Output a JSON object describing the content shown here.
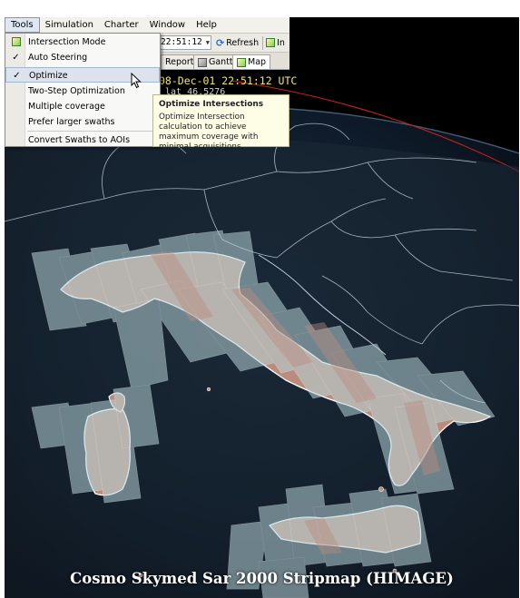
{
  "menubar": {
    "items": [
      {
        "label": "Tools",
        "active": true
      },
      {
        "label": "Simulation",
        "active": false
      },
      {
        "label": "Charter",
        "active": false
      },
      {
        "label": "Window",
        "active": false
      },
      {
        "label": "Help",
        "active": false
      }
    ]
  },
  "toolbar": {
    "time_value": "22:51:12",
    "refresh_label": "Refresh",
    "in_label": "In"
  },
  "tabs": [
    {
      "label": "Report",
      "icon": "report-icon"
    },
    {
      "label": "Gantt",
      "icon": "gantt-icon"
    },
    {
      "label": "Map",
      "icon": "map-icon",
      "selected": true
    }
  ],
  "tools_menu": {
    "items": [
      {
        "label": "Intersection Mode",
        "checked": false,
        "icon": "intersection-mode-icon"
      },
      {
        "label": "Auto Steering",
        "checked": true
      },
      {
        "label": "Optimize",
        "checked": true,
        "highlighted": true
      },
      {
        "label": "Two-Step Optimization",
        "checked": false
      },
      {
        "label": "Multiple coverage",
        "checked": false
      },
      {
        "label": "Prefer larger swaths",
        "checked": false
      },
      {
        "label": "Convert Swaths to AOIs",
        "checked": false
      }
    ]
  },
  "tooltip": {
    "title": "Optimize Intersections",
    "body": "Optimize Intersection calculation to achieve maximum coverage with minimal acquisitions"
  },
  "map_overlay": {
    "timestamp": "08-Dec-01 22:51:12 UTC",
    "latitude_readout": "lat 46.5276"
  },
  "caption": "Cosmo Skymed Sar 2000 Stripmap (HIMAGE)",
  "colors": {
    "land_fill": "#b98c7e",
    "swath_fill": "#b7d3d8",
    "border_line": "#ffffff",
    "orbit_line": "#c2221e",
    "timestamp_text": "#f2e66a"
  }
}
